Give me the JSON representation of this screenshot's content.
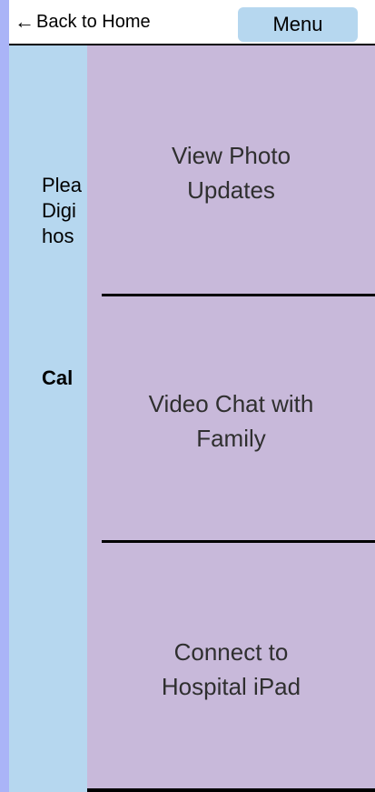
{
  "header": {
    "back_arrow": "←",
    "back_label": "Back to Home",
    "menu_label": "Menu"
  },
  "underlay": {
    "body_lines": [
      "Plea",
      "Digi",
      "hos"
    ],
    "bold_text": "Cal"
  },
  "menu": {
    "items": [
      {
        "lines": [
          "View Photo",
          "Updates"
        ]
      },
      {
        "lines": [
          "Video Chat with",
          "Family"
        ]
      },
      {
        "lines": [
          "Connect to",
          "Hospital iPad"
        ]
      }
    ]
  },
  "colors": {
    "outer_background": "#aab4f7",
    "screen_background": "#b6d7ef",
    "menu_panel": "#c8b9da",
    "header_background": "#ffffff",
    "menu_button": "#b6d7ef",
    "menu_text": "#2f2f2f"
  }
}
